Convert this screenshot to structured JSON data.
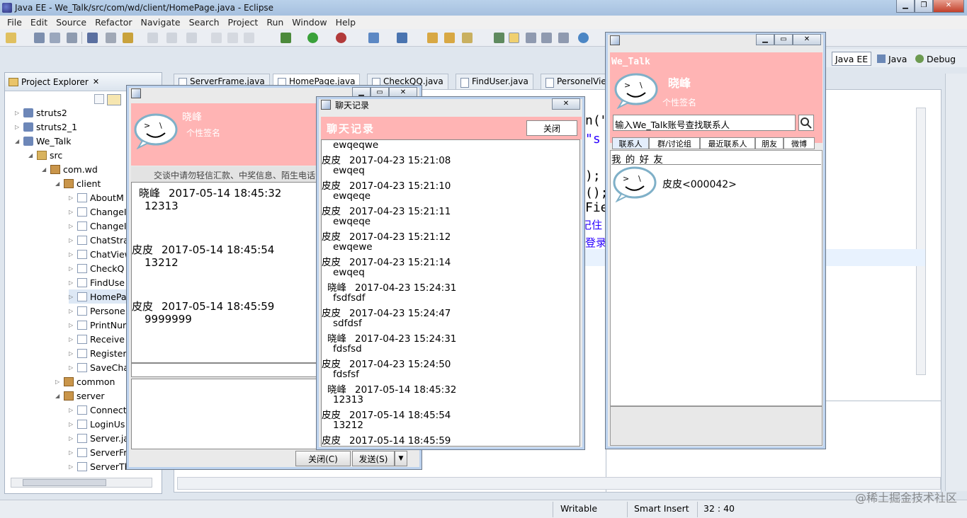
{
  "eclipse": {
    "title": "Java EE - We_Talk/src/com/wd/client/HomePage.java - Eclipse",
    "menu": [
      "File",
      "Edit",
      "Source",
      "Refactor",
      "Navigate",
      "Search",
      "Project",
      "Run",
      "Window",
      "Help"
    ],
    "project_explorer": {
      "title": "Project Explorer",
      "tree": [
        {
          "label": "struts2",
          "type": "proj"
        },
        {
          "label": "struts2_1",
          "type": "proj"
        },
        {
          "label": "We_Talk",
          "type": "proj"
        },
        {
          "label": "src",
          "type": "folder"
        },
        {
          "label": "com.wd",
          "type": "pkg"
        },
        {
          "label": "client",
          "type": "pkg"
        },
        {
          "label": "AboutM",
          "type": "jfile"
        },
        {
          "label": "ChangeI",
          "type": "jfile"
        },
        {
          "label": "ChangeI",
          "type": "jfile"
        },
        {
          "label": "ChatStra",
          "type": "jfile"
        },
        {
          "label": "ChatView",
          "type": "jfile"
        },
        {
          "label": "CheckQ",
          "type": "jfile"
        },
        {
          "label": "FindUse",
          "type": "jfile"
        },
        {
          "label": "HomePa",
          "type": "jfile"
        },
        {
          "label": "Persone",
          "type": "jfile"
        },
        {
          "label": "PrintNur",
          "type": "jfile"
        },
        {
          "label": "Receive",
          "type": "jfile"
        },
        {
          "label": "Register",
          "type": "jfile"
        },
        {
          "label": "SaveCha",
          "type": "jfile"
        },
        {
          "label": "common",
          "type": "pkg"
        },
        {
          "label": "server",
          "type": "pkg"
        },
        {
          "label": "Connect",
          "type": "jfile"
        },
        {
          "label": "LoginUs",
          "type": "jfile"
        },
        {
          "label": "Server.ja",
          "type": "jfile"
        },
        {
          "label": "ServerFr",
          "type": "jfile"
        },
        {
          "label": "ServerThread",
          "type": "jfile"
        }
      ]
    },
    "editor_tabs": [
      "ServerFrame.java",
      "HomePage.java",
      "CheckQQ.java",
      "FindUser.java",
      "PersonelView"
    ],
    "code_fragments": [
      "n(\"",
      "\"s",
      ");",
      "();",
      "Fie",
      "记住",
      "登录"
    ],
    "perspectives": [
      "Java EE",
      "Java",
      "Debug"
    ],
    "status": {
      "mode": "Writable",
      "insert": "Smart Insert",
      "position": "32 : 40"
    }
  },
  "chat_window": {
    "user_name": "晓峰",
    "signature": "个性签名",
    "notice": "交谈中请勿轻信汇款、中奖信息、陌生电话",
    "messages": [
      {
        "sender": "晓峰",
        "time": "2017-05-14 18:45:32",
        "text": "12313"
      },
      {
        "sender": "皮皮",
        "time": "2017-05-14 18:45:54",
        "text": "13212"
      },
      {
        "sender": "皮皮",
        "time": "2017-05-14 18:45:59",
        "text": "9999999"
      }
    ],
    "close_button": "关闭(C)",
    "send_button": "发送(S)"
  },
  "history_window": {
    "title": "聊天记录",
    "header": "聊天记录",
    "close_button": "关闭",
    "entries": [
      {
        "sender": "",
        "time": "",
        "text": "ewqeqwe"
      },
      {
        "sender": "皮皮",
        "time": "2017-04-23 15:21:08",
        "text": "ewqeq"
      },
      {
        "sender": "皮皮",
        "time": "2017-04-23 15:21:10",
        "text": "ewqeqe"
      },
      {
        "sender": "皮皮",
        "time": "2017-04-23 15:21:11",
        "text": "ewqeqe"
      },
      {
        "sender": "皮皮",
        "time": "2017-04-23 15:21:12",
        "text": "ewqewe"
      },
      {
        "sender": "皮皮",
        "time": "2017-04-23 15:21:14",
        "text": "ewqeq"
      },
      {
        "sender": "晓峰",
        "time": "2017-04-23 15:24:31",
        "text": "fsdfsdf"
      },
      {
        "sender": "皮皮",
        "time": "2017-04-23 15:24:47",
        "text": "sdfdsf"
      },
      {
        "sender": "晓峰",
        "time": "2017-04-23 15:24:31",
        "text": "fdsfsd"
      },
      {
        "sender": "皮皮",
        "time": "2017-04-23 15:24:50",
        "text": "fdsfsf"
      },
      {
        "sender": "晓峰",
        "time": "2017-05-14 18:45:32",
        "text": "12313"
      },
      {
        "sender": "皮皮",
        "time": "2017-05-14 18:45:54",
        "text": "13212"
      },
      {
        "sender": "皮皮",
        "time": "2017-05-14 18:45:59",
        "text": ""
      }
    ]
  },
  "main_window": {
    "app_name": "We_Talk",
    "user_name": "晓峰",
    "signature": "个性签名",
    "search_placeholder": "输入We_Talk账号查找联系人",
    "tabs": [
      "联系人",
      "群/讨论组",
      "最近联系人",
      "朋友",
      "微博"
    ],
    "group_label": "我 的 好 友",
    "contacts": [
      {
        "name": "皮皮<000042>"
      }
    ]
  },
  "watermark": "@稀土掘金技术社区"
}
